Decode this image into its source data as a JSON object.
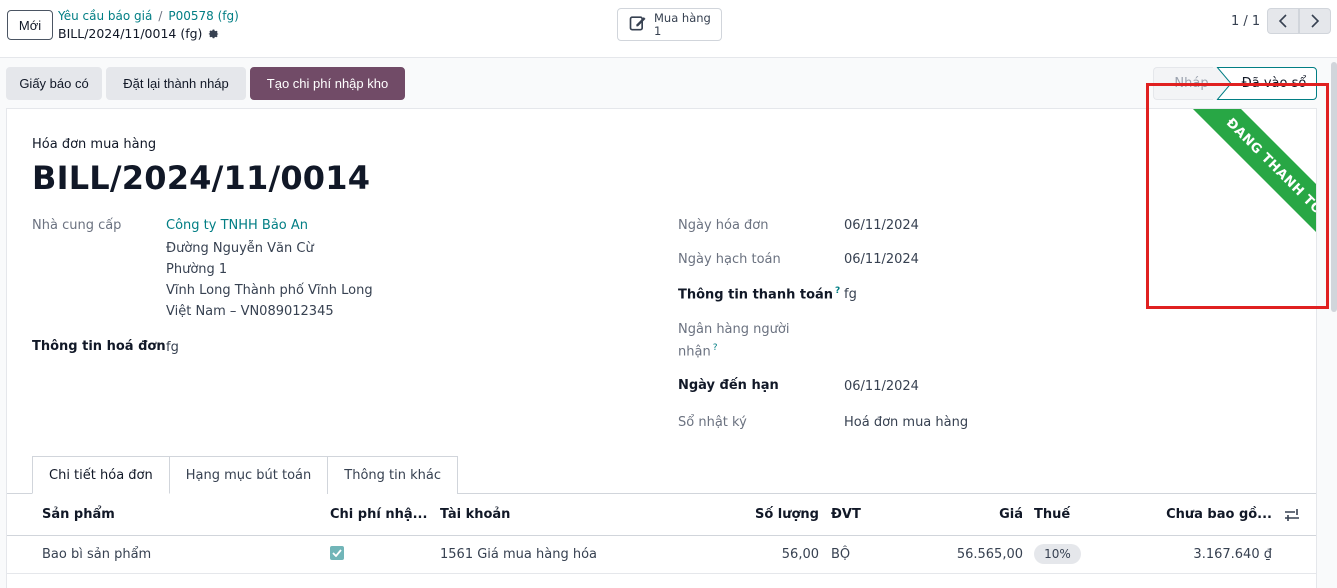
{
  "control_panel": {
    "new_button": "Mới",
    "breadcrumb_parent": "Yêu cầu báo giá",
    "breadcrumb_separator": "/",
    "breadcrumb_order": "P00578 (fg)",
    "record_name": "BILL/2024/11/0014 (fg)",
    "smart_button_label": "Mua hàng",
    "smart_button_count": "1",
    "pager_value": "1 / 1"
  },
  "status_bar": {
    "buttons": [
      "Giấy báo có",
      "Đặt lại thành nháp",
      "Tạo chi phí nhập kho"
    ],
    "stages": [
      "Nháp",
      "Đã vào sổ"
    ]
  },
  "sheet": {
    "doc_type": "Hóa đơn mua hàng",
    "doc_name": "BILL/2024/11/0014",
    "ribbon": "ĐANG THANH TOÁN",
    "vendor_label": "Nhà cung cấp",
    "vendor_name": "Công ty TNHH Bảo An",
    "vendor_address": [
      "Đường Nguyễn Văn Cừ",
      "Phường 1",
      "Vĩnh Long Thành phố Vĩnh Long",
      "Việt Nam – VN089012345"
    ],
    "bill_ref_label": "Thông tin hoá đơn",
    "bill_ref_value": "fg",
    "invoice_date_label": "Ngày hóa đơn",
    "invoice_date_value": "06/11/2024",
    "accounting_date_label": "Ngày hạch toán",
    "accounting_date_value": "06/11/2024",
    "payment_ref_label": "Thông tin thanh toán",
    "payment_ref_value": "fg",
    "bank_label_line1": "Ngân hàng người",
    "bank_label_line2": "nhận",
    "help_mark": "?",
    "due_date_label": "Ngày đến hạn",
    "due_date_value": "06/11/2024",
    "journal_label": "Sổ nhật ký",
    "journal_value": "Hoá đơn mua hàng"
  },
  "tabs": [
    "Chi tiết hóa đơn",
    "Hạng mục bút toán",
    "Thông tin khác"
  ],
  "table": {
    "headers": {
      "product": "Sản phẩm",
      "landed_cost": "Chi phí nhậ...",
      "account": "Tài khoản",
      "quantity": "Số lượng",
      "uom": "ĐVT",
      "price": "Giá",
      "tax": "Thuế",
      "subtotal": "Chưa bao gồ..."
    },
    "rows": [
      {
        "product": "Bao bì sản phẩm",
        "landed_cost": true,
        "account": "1561 Giá mua hàng hóa",
        "quantity": "56,00",
        "uom": "BỘ",
        "price": "56.565,00",
        "tax": "10%",
        "subtotal": "3.167.640 ₫"
      }
    ]
  },
  "colors": {
    "primary": "#714b67",
    "link": "#017e84",
    "ribbon": "#28a745",
    "highlight": "#e02020"
  }
}
